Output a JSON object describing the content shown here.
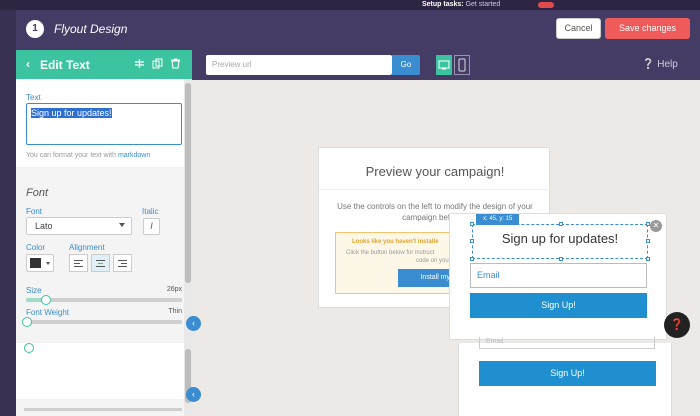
{
  "back_app": {
    "setup_label": "Setup tasks:",
    "setup_text": "Get started"
  },
  "header": {
    "step": "1",
    "title": "Flyout Design",
    "cancel_label": "Cancel",
    "save_label": "Save changes"
  },
  "editor": {
    "title": "Edit Text",
    "text_label": "Text",
    "text_value": "Sign up for updates!",
    "hint_prefix": "You can format your text with",
    "hint_link": "markdown",
    "font_section": "Font",
    "font_label": "Font",
    "font_value": "Lato",
    "italic_label": "Italic",
    "italic_button": "I",
    "color_label": "Color",
    "color_value": "#333333",
    "alignment_label": "Alignment",
    "alignment_options": [
      "left",
      "center",
      "right"
    ],
    "alignment_selected": "center",
    "size_label": "Size",
    "size_value": "26px",
    "weight_label": "Font Weight",
    "weight_value": "Thin"
  },
  "toolbar": {
    "url_placeholder": "Preview url",
    "go_label": "Go",
    "devices": [
      "desktop-icon",
      "mobile-icon"
    ],
    "device_selected": "desktop",
    "help_label": "Help"
  },
  "preview": {
    "title": "Preview your campaign!",
    "description": "Use the controls on the left to modify the design of your campaign before it",
    "warning_title": "Looks like you haven't installe",
    "warning_text": "Click the button below for instruct",
    "warning_text2": "code on your",
    "warning_button": "Install my c"
  },
  "flyout": {
    "coord_text": "x: 45, y: 15",
    "heading": "Sign up for updates!",
    "email_placeholder": "Email",
    "button_label": "Sign Up!"
  },
  "lower": {
    "email_placeholder": "Email",
    "button_label": "Sign Up!"
  },
  "colors": {
    "accent": "#3cc3a0",
    "header": "#453c66",
    "primary": "#3a8dd0",
    "save": "#ef5b5b"
  }
}
